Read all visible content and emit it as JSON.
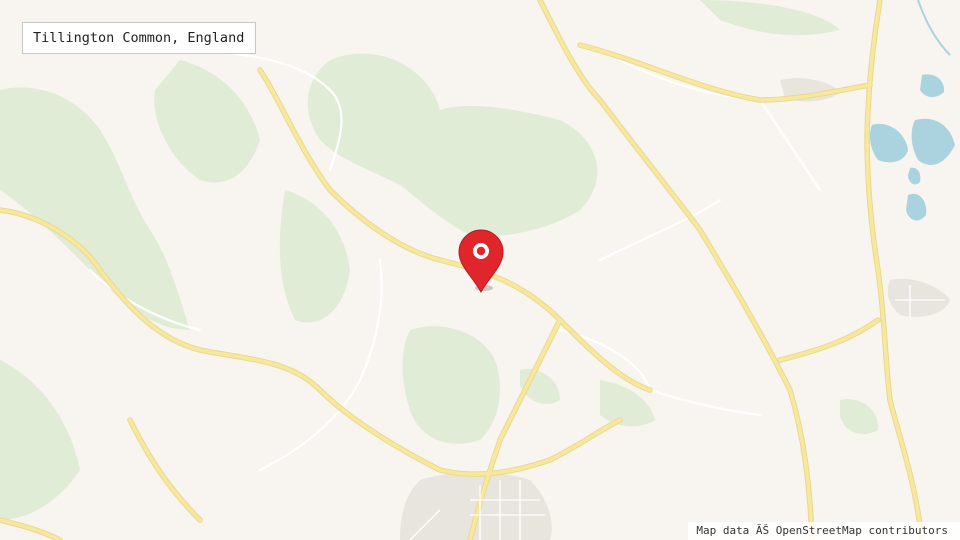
{
  "location_label": "Tillington Common, England",
  "attribution": "Map data ĂŠ OpenStreetMap contributors",
  "marker": {
    "icon": "map-pin-icon",
    "color": "#e0262b"
  },
  "colors": {
    "land": "#f8f5f0",
    "woodland": "#dfebd3",
    "water": "#aad3df",
    "major_road": "#f7e8a0",
    "minor_road": "#ffffff",
    "urban": "#e9e6e1"
  }
}
